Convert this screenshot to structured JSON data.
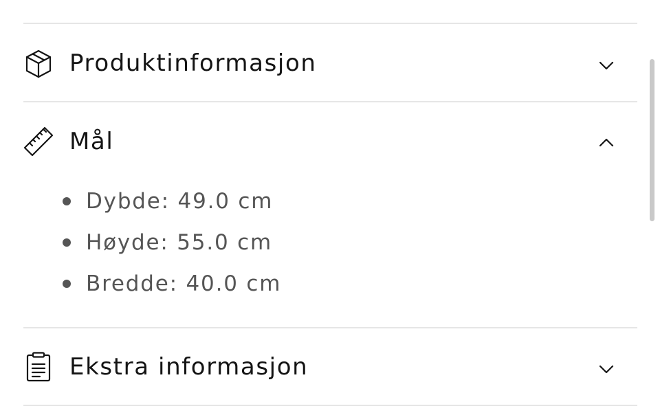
{
  "sections": [
    {
      "title": "Produktinformasjon",
      "icon": "package-icon",
      "expanded": false
    },
    {
      "title": "Mål",
      "icon": "ruler-icon",
      "expanded": true
    },
    {
      "title": "Ekstra informasjon",
      "icon": "clipboard-icon",
      "expanded": false
    }
  ],
  "dimensions": [
    "Dybde: 49.0 cm",
    "Høyde: 55.0 cm",
    "Bredde: 40.0 cm"
  ],
  "icons": {
    "collapsed_chevron": "chevron-down-icon",
    "expanded_chevron": "chevron-up-icon"
  },
  "colors": {
    "text_primary": "#141414",
    "text_secondary": "#555555",
    "divider": "#e6e6e6",
    "scrollbar": "#c9c9c9"
  }
}
